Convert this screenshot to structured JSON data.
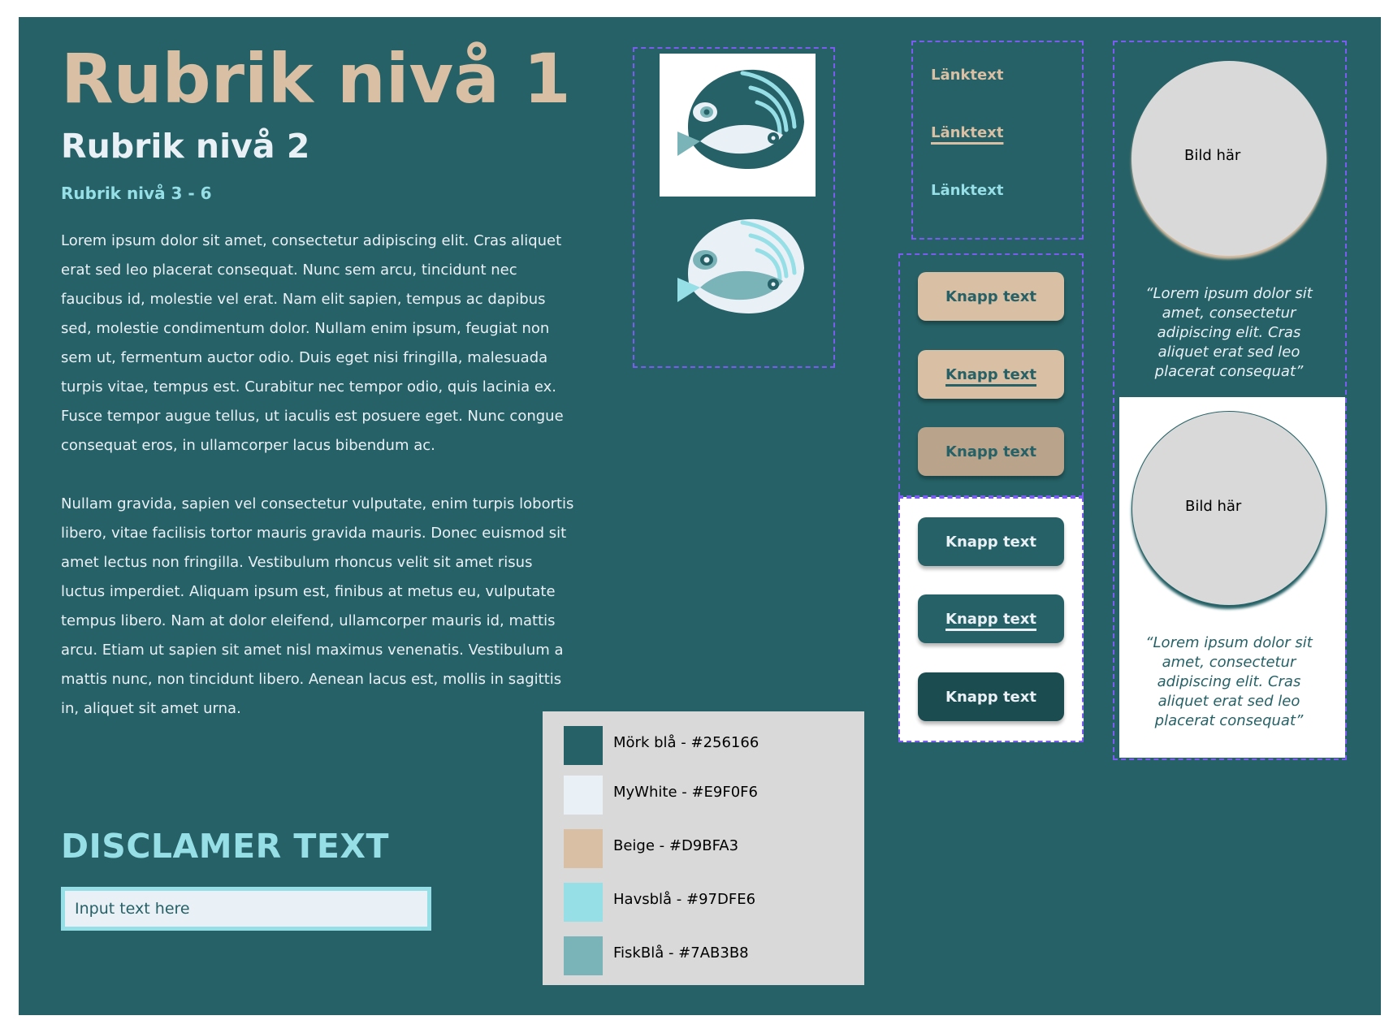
{
  "headings": {
    "h1": "Rubrik nivå 1",
    "h2": "Rubrik nivå 2",
    "h3": "Rubrik nivå 3 - 6"
  },
  "body_paragraphs": [
    "Lorem ipsum dolor sit amet, consectetur adipiscing elit. Cras aliquet erat sed leo placerat consequat. Nunc sem arcu, tincidunt nec faucibus id, molestie vel erat. Nam elit sapien, tempus ac dapibus sed, molestie condimentum dolor. Nullam enim ipsum, feugiat non sem ut, fermentum auctor odio. Duis eget nisi fringilla, malesuada turpis vitae, tempus est. Curabitur nec tempor odio, quis lacinia ex. Fusce tempor augue tellus, ut iaculis est posuere eget. Nunc congue consequat eros, in ullamcorper lacus bibendum ac.",
    "Nullam gravida, sapien vel consectetur vulputate, enim turpis lobortis libero, vitae facilisis tortor mauris gravida mauris. Donec euismod sit amet lectus non fringilla. Vestibulum rhoncus velit sit amet risus luctus imperdiet. Aliquam ipsum est, finibus at metus eu, vulputate tempus libero. Nam at dolor eleifend, ullamcorper mauris id, mattis arcu. Etiam ut sapien sit amet nisl maximus venenatis. Vestibulum a mattis nunc, non tincidunt libero. Aenean lacus est, mollis in sagittis in, aliquet sit amet urna."
  ],
  "disclaimer": "DISCLAMER TEXT",
  "input": {
    "placeholder": "Input text here"
  },
  "links": [
    "Länktext",
    "Länktext",
    "Länktext"
  ],
  "buttons": [
    "Knapp text",
    "Knapp text",
    "Knapp text",
    "Knapp text",
    "Knapp text",
    "Knapp text"
  ],
  "image_placeholders": [
    "Bild här",
    "Bild här"
  ],
  "quotes": [
    "“Lorem ipsum dolor sit amet, consectetur adipiscing elit. Cras aliquet erat sed leo placerat consequat”",
    "“Lorem ipsum dolor sit amet, consectetur adipiscing elit. Cras aliquet erat sed leo placerat consequat”"
  ],
  "palette": [
    {
      "label": "Mörk blå - #256166",
      "color": "#256166"
    },
    {
      "label": "MyWhite - #E9F0F6",
      "color": "#E9F0F6"
    },
    {
      "label": "Beige - #D9BFA3",
      "color": "#D9BFA3"
    },
    {
      "label": "Havsblå - #97DFE6",
      "color": "#97DFE6"
    },
    {
      "label": "FiskBlå - #7AB3B8",
      "color": "#7AB3B8"
    }
  ],
  "icons": {
    "logo_light_bg": "fish-logo-icon",
    "logo_dark_bg": "fish-logo-inverted-icon"
  }
}
